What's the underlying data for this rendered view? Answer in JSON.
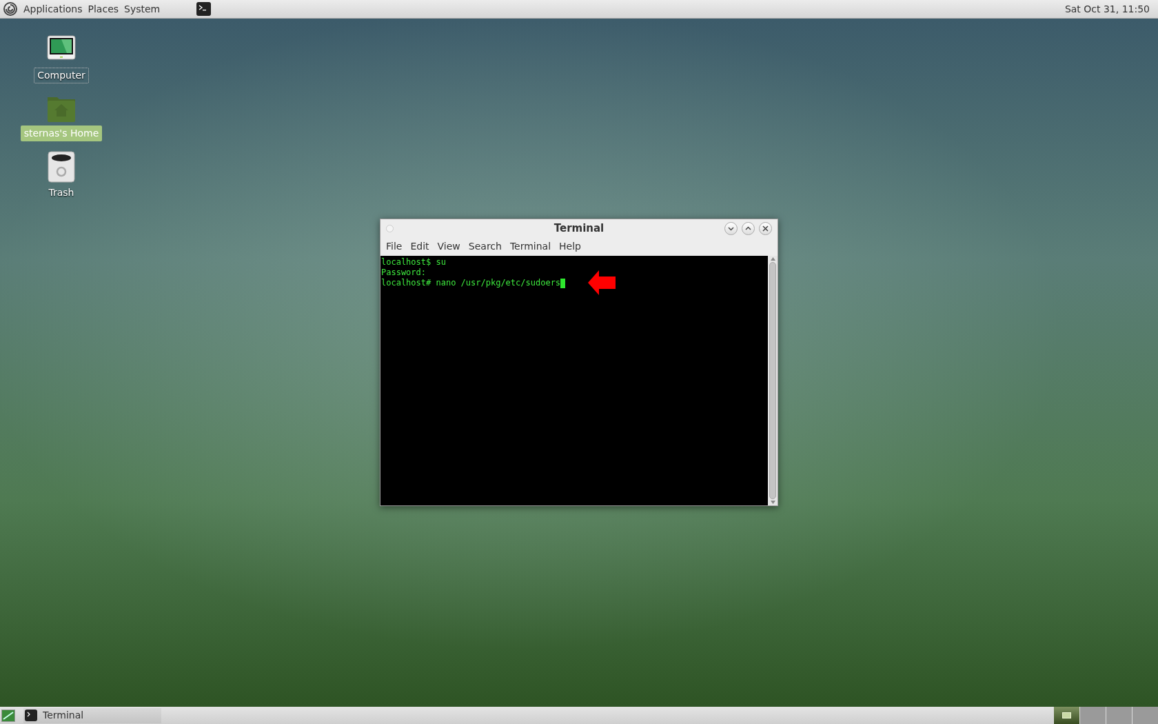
{
  "top_panel": {
    "menus": [
      "Applications",
      "Places",
      "System"
    ],
    "clock": "Sat Oct 31, 11:50"
  },
  "desktop_icons": [
    {
      "kind": "computer",
      "label": "Computer",
      "selected": false,
      "focused": true
    },
    {
      "kind": "home",
      "label": "sternas's Home",
      "selected": true,
      "focused": false
    },
    {
      "kind": "trash",
      "label": "Trash",
      "selected": false,
      "focused": false
    }
  ],
  "window": {
    "title": "Terminal",
    "menu": [
      "File",
      "Edit",
      "View",
      "Search",
      "Terminal",
      "Help"
    ],
    "lines": [
      "localhost$ su",
      "Password:",
      "localhost# nano /usr/pkg/etc/sudoers"
    ]
  },
  "bottom_panel": {
    "task": "Terminal",
    "workspaces": [
      {
        "selected": true
      },
      {
        "selected": false
      },
      {
        "selected": false
      },
      {
        "selected": false
      }
    ]
  }
}
